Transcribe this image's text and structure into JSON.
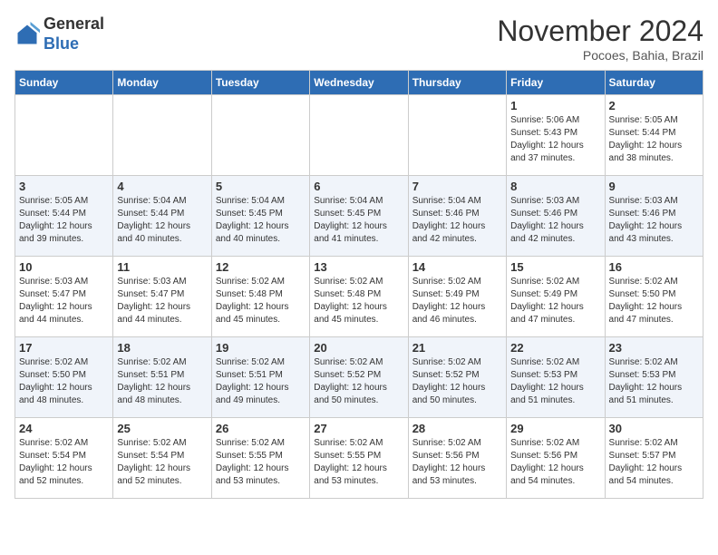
{
  "logo": {
    "general": "General",
    "blue": "Blue"
  },
  "header": {
    "month": "November 2024",
    "location": "Pocoes, Bahia, Brazil"
  },
  "weekdays": [
    "Sunday",
    "Monday",
    "Tuesday",
    "Wednesday",
    "Thursday",
    "Friday",
    "Saturday"
  ],
  "weeks": [
    [
      {
        "day": "",
        "info": ""
      },
      {
        "day": "",
        "info": ""
      },
      {
        "day": "",
        "info": ""
      },
      {
        "day": "",
        "info": ""
      },
      {
        "day": "",
        "info": ""
      },
      {
        "day": "1",
        "info": "Sunrise: 5:06 AM\nSunset: 5:43 PM\nDaylight: 12 hours and 37 minutes."
      },
      {
        "day": "2",
        "info": "Sunrise: 5:05 AM\nSunset: 5:44 PM\nDaylight: 12 hours and 38 minutes."
      }
    ],
    [
      {
        "day": "3",
        "info": "Sunrise: 5:05 AM\nSunset: 5:44 PM\nDaylight: 12 hours and 39 minutes."
      },
      {
        "day": "4",
        "info": "Sunrise: 5:04 AM\nSunset: 5:44 PM\nDaylight: 12 hours and 40 minutes."
      },
      {
        "day": "5",
        "info": "Sunrise: 5:04 AM\nSunset: 5:45 PM\nDaylight: 12 hours and 40 minutes."
      },
      {
        "day": "6",
        "info": "Sunrise: 5:04 AM\nSunset: 5:45 PM\nDaylight: 12 hours and 41 minutes."
      },
      {
        "day": "7",
        "info": "Sunrise: 5:04 AM\nSunset: 5:46 PM\nDaylight: 12 hours and 42 minutes."
      },
      {
        "day": "8",
        "info": "Sunrise: 5:03 AM\nSunset: 5:46 PM\nDaylight: 12 hours and 42 minutes."
      },
      {
        "day": "9",
        "info": "Sunrise: 5:03 AM\nSunset: 5:46 PM\nDaylight: 12 hours and 43 minutes."
      }
    ],
    [
      {
        "day": "10",
        "info": "Sunrise: 5:03 AM\nSunset: 5:47 PM\nDaylight: 12 hours and 44 minutes."
      },
      {
        "day": "11",
        "info": "Sunrise: 5:03 AM\nSunset: 5:47 PM\nDaylight: 12 hours and 44 minutes."
      },
      {
        "day": "12",
        "info": "Sunrise: 5:02 AM\nSunset: 5:48 PM\nDaylight: 12 hours and 45 minutes."
      },
      {
        "day": "13",
        "info": "Sunrise: 5:02 AM\nSunset: 5:48 PM\nDaylight: 12 hours and 45 minutes."
      },
      {
        "day": "14",
        "info": "Sunrise: 5:02 AM\nSunset: 5:49 PM\nDaylight: 12 hours and 46 minutes."
      },
      {
        "day": "15",
        "info": "Sunrise: 5:02 AM\nSunset: 5:49 PM\nDaylight: 12 hours and 47 minutes."
      },
      {
        "day": "16",
        "info": "Sunrise: 5:02 AM\nSunset: 5:50 PM\nDaylight: 12 hours and 47 minutes."
      }
    ],
    [
      {
        "day": "17",
        "info": "Sunrise: 5:02 AM\nSunset: 5:50 PM\nDaylight: 12 hours and 48 minutes."
      },
      {
        "day": "18",
        "info": "Sunrise: 5:02 AM\nSunset: 5:51 PM\nDaylight: 12 hours and 48 minutes."
      },
      {
        "day": "19",
        "info": "Sunrise: 5:02 AM\nSunset: 5:51 PM\nDaylight: 12 hours and 49 minutes."
      },
      {
        "day": "20",
        "info": "Sunrise: 5:02 AM\nSunset: 5:52 PM\nDaylight: 12 hours and 50 minutes."
      },
      {
        "day": "21",
        "info": "Sunrise: 5:02 AM\nSunset: 5:52 PM\nDaylight: 12 hours and 50 minutes."
      },
      {
        "day": "22",
        "info": "Sunrise: 5:02 AM\nSunset: 5:53 PM\nDaylight: 12 hours and 51 minutes."
      },
      {
        "day": "23",
        "info": "Sunrise: 5:02 AM\nSunset: 5:53 PM\nDaylight: 12 hours and 51 minutes."
      }
    ],
    [
      {
        "day": "24",
        "info": "Sunrise: 5:02 AM\nSunset: 5:54 PM\nDaylight: 12 hours and 52 minutes."
      },
      {
        "day": "25",
        "info": "Sunrise: 5:02 AM\nSunset: 5:54 PM\nDaylight: 12 hours and 52 minutes."
      },
      {
        "day": "26",
        "info": "Sunrise: 5:02 AM\nSunset: 5:55 PM\nDaylight: 12 hours and 53 minutes."
      },
      {
        "day": "27",
        "info": "Sunrise: 5:02 AM\nSunset: 5:55 PM\nDaylight: 12 hours and 53 minutes."
      },
      {
        "day": "28",
        "info": "Sunrise: 5:02 AM\nSunset: 5:56 PM\nDaylight: 12 hours and 53 minutes."
      },
      {
        "day": "29",
        "info": "Sunrise: 5:02 AM\nSunset: 5:56 PM\nDaylight: 12 hours and 54 minutes."
      },
      {
        "day": "30",
        "info": "Sunrise: 5:02 AM\nSunset: 5:57 PM\nDaylight: 12 hours and 54 minutes."
      }
    ]
  ]
}
